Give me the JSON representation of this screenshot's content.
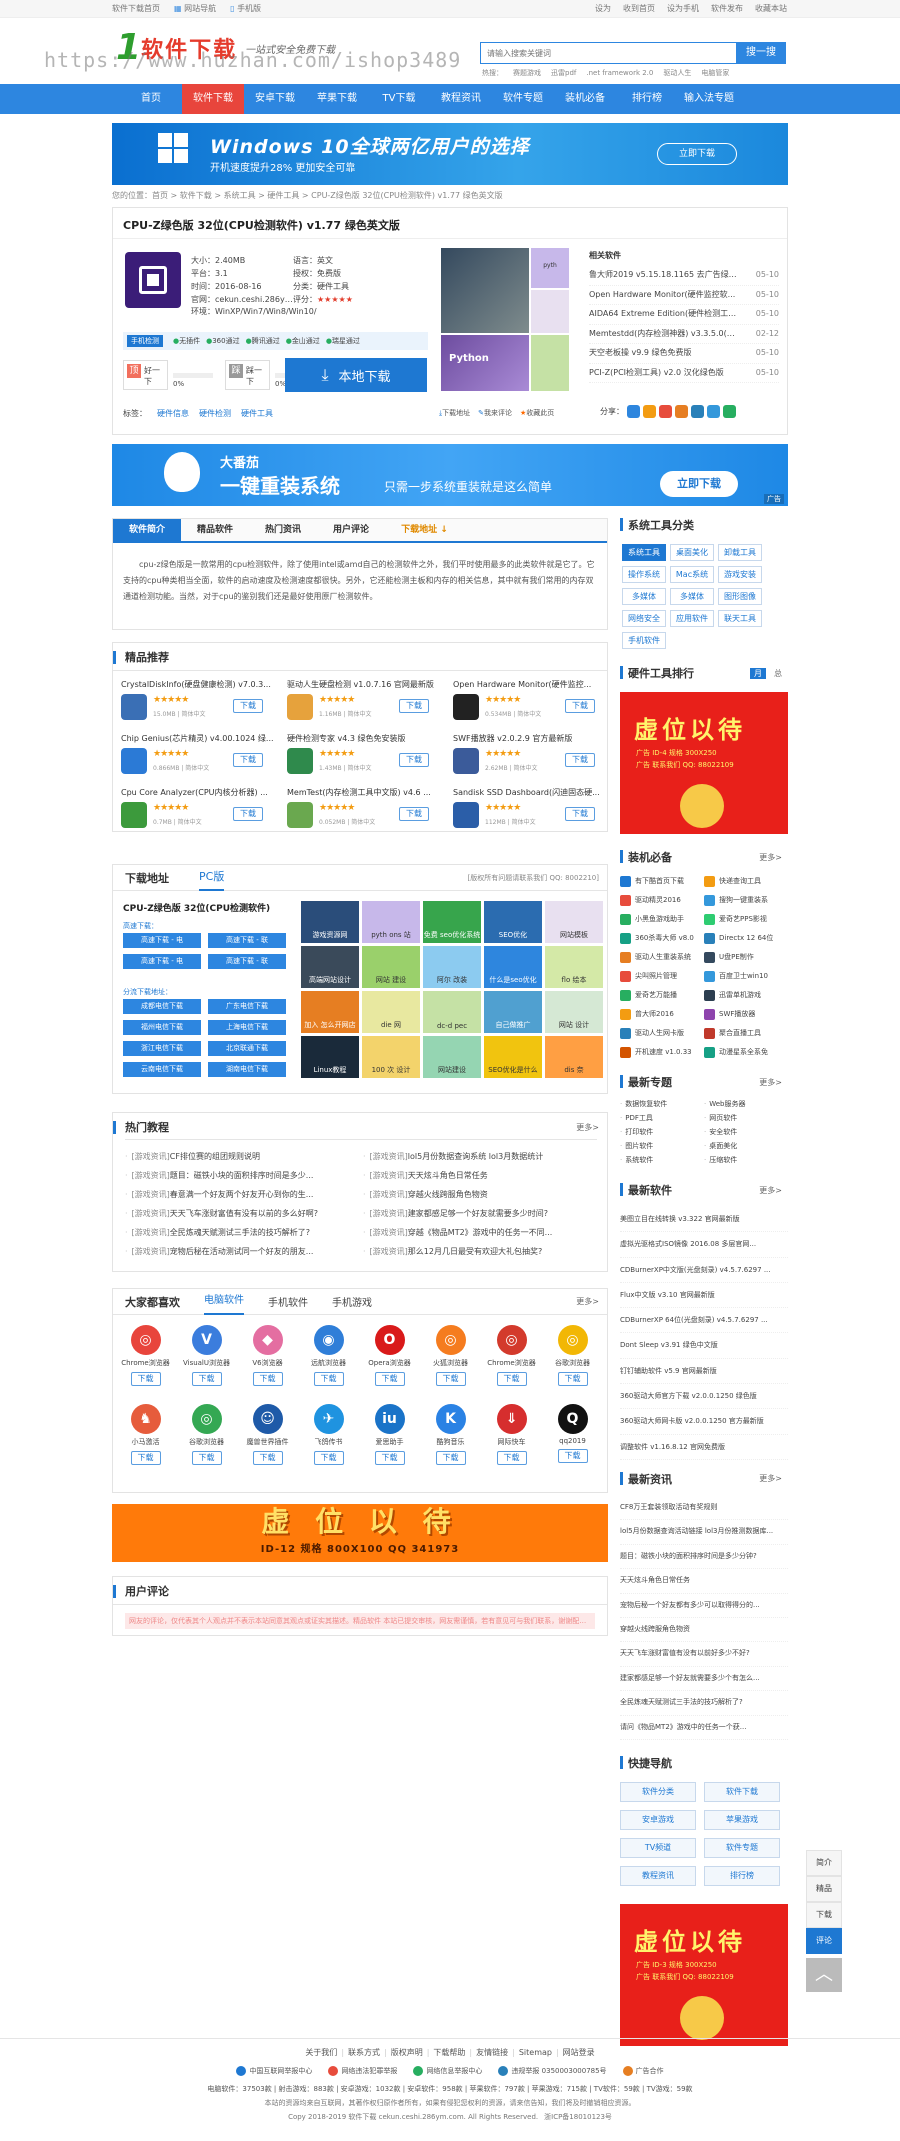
{
  "topbar": {
    "left": [
      "软件下载首页",
      "网站导航",
      "手机版"
    ],
    "right": [
      "设为",
      "收到首页",
      "设为手机",
      "软件发布",
      "收藏本站"
    ]
  },
  "header": {
    "logo": "软件下载",
    "slogan": "一站式安全免费下载",
    "watermark": "https://www.huzhan.com/ishop3489",
    "search_placeholder": "请输入搜索关键词",
    "search_button": "搜一搜",
    "hot_label": "热搜：",
    "hot": [
      "赛题游戏",
      "迅雷pdf",
      ".net framework 2.0",
      "驱动人生",
      "电脑管家"
    ]
  },
  "nav": [
    "首页",
    "软件下载",
    "安卓下载",
    "苹果下载",
    "TV下载",
    "教程资讯",
    "软件专题",
    "装机必备",
    "排行榜",
    "输入法专题"
  ],
  "nav_active": 1,
  "banner1": {
    "title": "Windows 10全球两亿用户的选择",
    "sub": "开机速度提升28% 更加安全可靠",
    "btn": "立即下载"
  },
  "breadcrumb": "您的位置：首页 > 软件下载 > 系统工具 > 硬件工具 > CPU-Z绿色版 32位(CPU检测软件) v1.77 绿色英文版",
  "soft": {
    "title": "CPU-Z绿色版 32位(CPU检测软件) v1.77 绿色英文版",
    "info": [
      [
        "大小：",
        "2.40MB"
      ],
      [
        "语言：",
        "英文"
      ],
      [
        "平台：",
        "3.1"
      ],
      [
        "授权：",
        "免费版"
      ],
      [
        "时间：",
        "2016-08-16"
      ],
      [
        "分类：",
        "硬件工具"
      ],
      [
        "官网：",
        "cekun.ceshi.286ym.c..."
      ],
      [
        "评分：",
        "★★★★★"
      ]
    ],
    "env": "环境：WinXP/Win7/Win8/Win10/",
    "safe": [
      "手机检测",
      "无插件",
      "360通过",
      "腾讯通过",
      "金山通过",
      "瑞星通过"
    ],
    "good_label": "好一下",
    "good_pct": "0%",
    "bad_label": "踩一下",
    "bad_pct": "0%",
    "download_btn": "本地下载",
    "tags_label": "标签：",
    "tags": [
      "硬件信息",
      "硬件检测",
      "硬件工具"
    ],
    "actions": [
      "下载地址",
      "我来评论",
      "收藏此页"
    ],
    "share": "分享：",
    "related_title": "相关软件",
    "related": [
      [
        "鲁大师2019 v5.15.18.1165 去广告绿色版",
        "05-10"
      ],
      [
        "Open Hardware Monitor(硬件监控软...",
        "05-10"
      ],
      [
        "AIDA64 Extreme Edition(硬件检测工具...",
        "05-10"
      ],
      [
        "Memtestdd(内存检测神器) v3.3.5.0(32...",
        "02-12"
      ],
      [
        "天空老板操 v9.9 绿色免费版",
        "05-10"
      ],
      [
        "PCI-Z(PCI检测工具) v2.0 汉化绿色版",
        "05-10"
      ]
    ]
  },
  "banner2": {
    "brand": "大番茄",
    "title": "一键重装系统",
    "sub": "只需一步系统重装就是这么简单",
    "btn": "立即下载",
    "ad": "广告"
  },
  "tabs": [
    "软件简介",
    "精品软件",
    "热门资讯",
    "用户评论",
    "下载地址 ↓"
  ],
  "desc": "cpu-z绿色版是一款常用的cpu检测软件，除了使用intel或amd自己的检测软件之外，我们平时使用最多的此类软件就是它了。它支持的cpu种类相当全面，软件的启动速度及检测速度都很快。另外，它还能检测主板和内存的相关信息，其中就有我们常用的内存双通道检测功能。当然，对于cpu的鉴别我们还是最好使用原厂检测软件。",
  "featured": {
    "title": "精品推荐",
    "items": [
      {
        "name": "CrystalDiskInfo(硬盘健康检测) v7.0.3...",
        "meta": "15.0MB | 简体中文",
        "btn": "下载",
        "c": "#3a6fb5"
      },
      {
        "name": "驱动人生硬盘检测 v1.0.7.16 官网最新版",
        "meta": "1.16MB | 简体中文",
        "btn": "下载",
        "c": "#e6a23c"
      },
      {
        "name": "Open Hardware Monitor(硬件监控...",
        "meta": "0.534MB | 简体中文",
        "btn": "下载",
        "c": "#222"
      },
      {
        "name": "Chip Genius(芯片精灵) v4.00.1024 绿...",
        "meta": "0.866MB | 简体中文",
        "btn": "下载",
        "c": "#2b7ad6"
      },
      {
        "name": "硬件检测专家 v4.3 绿色免安装版",
        "meta": "1.43MB | 简体中文",
        "btn": "下载",
        "c": "#2f8a4c"
      },
      {
        "name": "SWF播放器 v2.0.2.9 官方最新版",
        "meta": "2.62MB | 简体中文",
        "btn": "下载",
        "c": "#3b5b9a"
      },
      {
        "name": "Cpu Core Analyzer(CPU内核分析器) ...",
        "meta": "0.7MB | 简体中文",
        "btn": "下载",
        "c": "#3c9a3c"
      },
      {
        "name": "MemTest(内存检测工具中文版) v4.6 ...",
        "meta": "0.052MB | 简体中文",
        "btn": "下载",
        "c": "#6aa84f"
      },
      {
        "name": "Sandisk SSD Dashboard(闪迪固态硬...",
        "meta": "112MB | 简体中文",
        "btn": "下载",
        "c": "#2b5ea8"
      }
    ]
  },
  "dl": {
    "tab1": "下载地址",
    "tab2": "PC版",
    "notice": "[版权所有问题请联系我们 QQ: 8002210]",
    "name": "CPU-Z绿色版 32位(CPU检测软件)",
    "g1": "高速下载：",
    "g2": "分流下载地址：",
    "fast": [
      "高速下载 - 电",
      "高速下载 - 联",
      "高速下载 - 电",
      "高速下载 - 联"
    ],
    "mirror": [
      "成都电信下载",
      "广东电信下载",
      "福州电信下载",
      "上海电信下载",
      "浙江电信下载",
      "北京联通下载",
      "云南电信下载",
      "湖南电信下载"
    ]
  },
  "tiles": [
    {
      "t": "游戏资源网",
      "c": "#2a4d7a"
    },
    {
      "t": "pyth ons 站",
      "c": "#c7b8ea"
    },
    {
      "t": "免费 seo优化系统",
      "c": "#37a54c"
    },
    {
      "t": "SEO优化",
      "c": "#2b6cb0"
    },
    {
      "t": "网站模板",
      "c": "#e8e0f0"
    },
    {
      "t": "高端网站设计",
      "c": "#3a4a5a"
    },
    {
      "t": "网站 建设",
      "c": "#9ad06b"
    },
    {
      "t": "阿尔 改装",
      "c": "#8ccbf0"
    },
    {
      "t": "什么是seo优化",
      "c": "#2e86de"
    },
    {
      "t": "flo 绘本",
      "c": "#d4e9a7"
    },
    {
      "t": "加入 怎么开网店",
      "c": "#e67e22"
    },
    {
      "t": "die 网",
      "c": "#e8e8a0"
    },
    {
      "t": "dc-d pec",
      "c": "#c5e1a5"
    },
    {
      "t": "自己做推广",
      "c": "#50a0d0"
    },
    {
      "t": "网站 设计",
      "c": "#d5e8d4"
    },
    {
      "t": "Linux教程",
      "c": "#1a2a3a"
    },
    {
      "t": "100 次 设计",
      "c": "#f3d36b"
    },
    {
      "t": "网站建设",
      "c": "#95d5b2"
    },
    {
      "t": "SEO优化是什么",
      "c": "#f1c40f"
    },
    {
      "t": "dis 奈",
      "c": "#ff9f43"
    }
  ],
  "hot": {
    "title": "热门教程",
    "more": "更多>",
    "items": [
      [
        "[游戏资讯]",
        "CF排位赛的组团规则说明"
      ],
      [
        "[游戏资讯]",
        "lol5月份数据查询系统 lol3月数据统计"
      ],
      [
        "[游戏资讯]",
        "题目：磁铁小块的面积排序时间是多少..."
      ],
      [
        "[游戏资讯]",
        "天天炫斗角色日常任务"
      ],
      [
        "[游戏资讯]",
        "春意满一个好友两个好友开心到你的生..."
      ],
      [
        "[游戏资讯]",
        "穿越火线跨服角色物资"
      ],
      [
        "[游戏资讯]",
        "天天飞车涨财富值有没有以前的多么好啊?"
      ],
      [
        "[游戏资讯]",
        "建家都感足够一个好友就需要多少时间?"
      ],
      [
        "[游戏资讯]",
        "全民炼魂天赋测试三手法的技巧解析了?"
      ],
      [
        "[游戏资讯]",
        "穿越《物品MT2》游戏中的任务一不同..."
      ],
      [
        "[游戏资讯]",
        "宠物后秘在活动测试同一个好友的朋友..."
      ],
      [
        "[游戏资讯]",
        "那么12月几日最受有欢迎大礼包抽奖?"
      ]
    ]
  },
  "apps": {
    "title": "大家都喜欢",
    "tabs": [
      "电脑软件",
      "手机软件",
      "手机游戏"
    ],
    "more": "更多>",
    "btn": "下载",
    "items": [
      {
        "n": "Chrome浏览器",
        "c": "#e8453c",
        "g": "◎"
      },
      {
        "n": "VisualU浏览器",
        "c": "#3b7ddd",
        "g": "V"
      },
      {
        "n": "V6浏览器",
        "c": "#e46ea1",
        "g": "◆"
      },
      {
        "n": "远航浏览器",
        "c": "#2f7ed8",
        "g": "◉"
      },
      {
        "n": "Opera浏览器",
        "c": "#d91a1a",
        "g": "O"
      },
      {
        "n": "火狐浏览器",
        "c": "#f57c1f",
        "g": "◎"
      },
      {
        "n": "Chrome浏览器",
        "c": "#d33a2c",
        "g": "◎"
      },
      {
        "n": "谷歌浏览器",
        "c": "#f2b705",
        "g": "◎"
      },
      {
        "n": "小马激活",
        "c": "#e65c3c",
        "g": "♞"
      },
      {
        "n": "谷歌浏览器",
        "c": "#34a853",
        "g": "◎"
      },
      {
        "n": "魔兽世界插件",
        "c": "#1e5aa8",
        "g": "☺"
      },
      {
        "n": "飞鸽传书",
        "c": "#1f93e0",
        "g": "✈"
      },
      {
        "n": "爱思助手",
        "c": "#1a73c8",
        "g": "iu"
      },
      {
        "n": "酷狗音乐",
        "c": "#2a82e4",
        "g": "K"
      },
      {
        "n": "网际快车",
        "c": "#d62e2e",
        "g": "⇓"
      },
      {
        "n": "qq2019",
        "c": "#111",
        "g": "Q"
      }
    ]
  },
  "banner3": {
    "big": "虚 位 以 待",
    "small": "ID-12  规格 800X100  QQ 341973"
  },
  "comment": {
    "title": "用户评论",
    "tip": "网友的评论，仅代表其个人观点并不表示本站同意其观点或证实其描述。精品软件 本站已提交审核，网友需谨慎，若有意见可与我们联系，谢谢配合。"
  },
  "side": {
    "cat_title": "系统工具分类",
    "cats": [
      "系统工具",
      "桌面美化",
      "卸载工具",
      "操作系统",
      "Mac系统",
      "游戏安装",
      "多媒体",
      "多媒体",
      "图形图像",
      "网络安全",
      "应用软件",
      "联天工具",
      "手机软件"
    ],
    "rank_title": "硬件工具排行",
    "rank_tabs": [
      "月",
      "总"
    ],
    "ad": {
      "big": "虚位以待",
      "lines": [
        "广告 ID-4    规格 300X250",
        "广告 联系我们 QQ: 88022109"
      ]
    },
    "must_title": "装机必备",
    "must_more": "更多>",
    "must": [
      [
        "有下酷首页下载",
        "#1e78d2"
      ],
      [
        "快递查询工具",
        "#f39c12"
      ],
      [
        "驱动精灵2016",
        "#e74c3c"
      ],
      [
        "搜狗一键重装系",
        "#3498db"
      ],
      [
        "小黑鱼游戏助手",
        "#27ae60"
      ],
      [
        "爱奇艺PPS影视",
        "#2ecc71"
      ],
      [
        "360杀毒大师 v8.0",
        "#16a085"
      ],
      [
        "Directx 12 64位",
        "#2980b9"
      ],
      [
        "驱动人生重装系统",
        "#e67e22"
      ],
      [
        "U盘PE制作",
        "#34495e"
      ],
      [
        "尖叫照片管理",
        "#e74c3c"
      ],
      [
        "百度卫士win10",
        "#3498db"
      ],
      [
        "爱奇艺万能播",
        "#27ae60"
      ],
      [
        "迅雷单机游戏",
        "#2c3e50"
      ],
      [
        "曾大师2016",
        "#f39c12"
      ],
      [
        "SWF播放器",
        "#8e44ad"
      ],
      [
        "驱动人生网卡版",
        "#2980b9"
      ],
      [
        "聚合直播工具",
        "#c0392b"
      ],
      [
        "开机速度 v1.0.33",
        "#d35400"
      ],
      [
        "动漫星系全系免",
        "#16a085"
      ]
    ],
    "topic_title": "最新专题",
    "topic_more": "更多>",
    "topics": [
      "数据恢复软件",
      "Web服务器",
      "PDF工具",
      "网页软件",
      "打印软件",
      "安全软件",
      "图片软件",
      "桌面美化",
      "系统软件",
      "压缩软件"
    ],
    "new_title": "最新软件",
    "new_more": "更多>",
    "news_soft": [
      "美图立目在线转换 v3.322 官网最新版",
      "虚拟光驱格式ISO镜像 2016.08 多层官网...",
      "CDBurnerXP中文版(光盘刻录) v4.5.7.6297 ...",
      "Flux中文版 v3.10 官网最新版",
      "CDBurnerXP 64位(光盘刻录) v4.5.7.6297 ...",
      "Dont Sleep v3.91 绿色中文版",
      "钉钉辅助软件 v5.9 官网最新版",
      "360驱动大师官方下载 v2.0.0.1250 绿色版",
      "360驱动大师网卡版 v2.0.0.1250 官方最新版",
      "调整软件 v1.16.8.12 官网免费版"
    ],
    "info_title": "最新资讯",
    "info_more": "更多>",
    "news_info": [
      "CF8万王套装领取活动有奖规则",
      "lol5月份数据查询活动链接 lol3月份推测数据库...",
      "题目：磁铁小块的面积排序时间是多少分钟?",
      "天天炫斗角色日常任务",
      "宠物后秘一个好友都有多少可以取得得分的...",
      "穿越火线跨服角色物资",
      "天天飞车涨财富值有没有以前好多少不好?",
      "建家都感足够一个好友就需要多少个有怎么...",
      "全民炼魂天赋测试三手法的技巧解析了?",
      "请问《物品MT2》游戏中的任务一个获..."
    ],
    "quick_title": "快捷导航",
    "quick": [
      "软件分类",
      "软件下载",
      "安卓游戏",
      "苹果游戏",
      "TV频道",
      "软件专题",
      "教程资讯",
      "排行榜"
    ],
    "ad2": {
      "big": "虚位以待",
      "lines": [
        "广告 ID-3    规格 300X250",
        "广告 联系我们 QQ: 88022109"
      ]
    }
  },
  "float": [
    "简介",
    "精品",
    "下载",
    "评论"
  ],
  "footer": {
    "links": [
      "关于我们",
      "联系方式",
      "版权声明",
      "下载帮助",
      "友情链接",
      "Sitemap",
      "网站登录"
    ],
    "badges": [
      "中国互联网举报中心",
      "网络违法犯罪举报",
      "网络信息举报中心",
      "违规举报 0350003000785号",
      "广告合作"
    ],
    "stats": "电脑软件：37503款 | 射击游戏：883款 | 安卓游戏：1032款 | 安卓软件：958款 | 苹果软件：797款 | 苹果游戏：715款 | TV软件：59款 | TV游戏：59款",
    "note": "本站的资源均来自互联网，其著作权归原作者所有，如果有侵犯您权利的资源，请来信告知，我们将及时撤销相应资源。",
    "copy": "Copy 2018-2019 软件下载 cekun.ceshi.286ym.com. All Rights Reserved.",
    "icp": "浙ICP备18010123号"
  }
}
